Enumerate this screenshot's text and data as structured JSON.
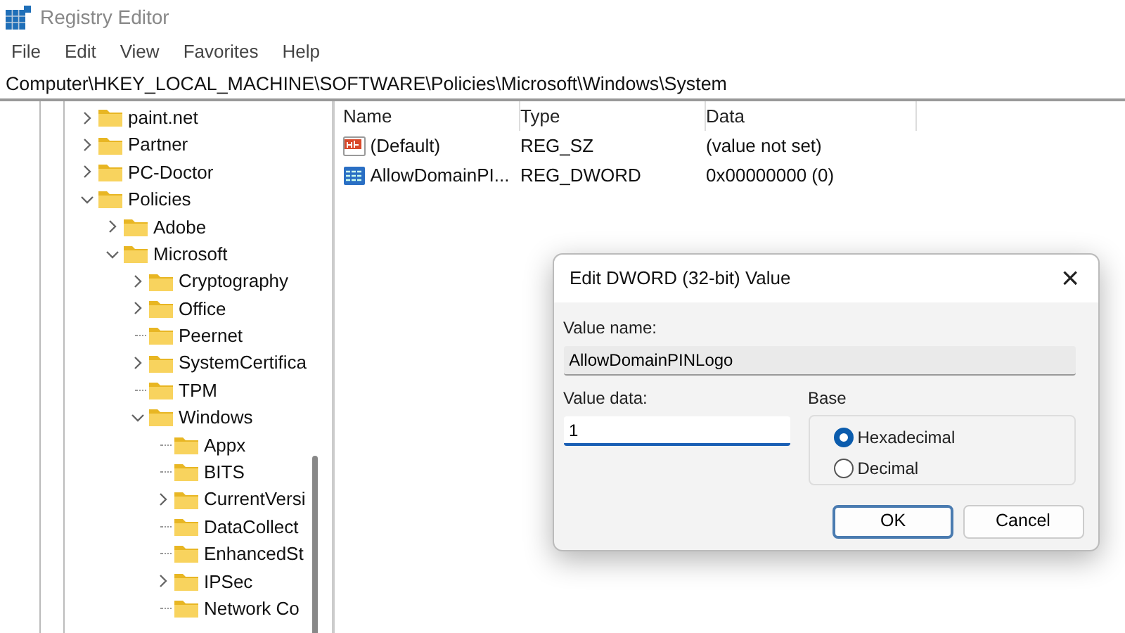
{
  "window": {
    "title": "Registry Editor"
  },
  "menu": [
    "File",
    "Edit",
    "View",
    "Favorites",
    "Help"
  ],
  "address": "Computer\\HKEY_LOCAL_MACHINE\\SOFTWARE\\Policies\\Microsoft\\Windows\\System",
  "tree": [
    {
      "label": "paint.net",
      "kind": "collapsed"
    },
    {
      "label": "Partner",
      "kind": "collapsed"
    },
    {
      "label": "PC-Doctor",
      "kind": "collapsed"
    },
    {
      "label": "Policies",
      "kind": "expanded",
      "children": [
        {
          "label": "Adobe",
          "kind": "collapsed"
        },
        {
          "label": "Microsoft",
          "kind": "expanded",
          "children": [
            {
              "label": "Cryptography",
              "kind": "collapsed"
            },
            {
              "label": "Office",
              "kind": "collapsed"
            },
            {
              "label": "Peernet",
              "kind": "leaf"
            },
            {
              "label": "SystemCertifica",
              "kind": "collapsed"
            },
            {
              "label": "TPM",
              "kind": "leaf"
            },
            {
              "label": "Windows",
              "kind": "expanded",
              "children": [
                {
                  "label": "Appx",
                  "kind": "leaf"
                },
                {
                  "label": "BITS",
                  "kind": "leaf"
                },
                {
                  "label": "CurrentVersi",
                  "kind": "collapsed"
                },
                {
                  "label": "DataCollect",
                  "kind": "leaf"
                },
                {
                  "label": "EnhancedSt",
                  "kind": "leaf"
                },
                {
                  "label": "IPSec",
                  "kind": "collapsed"
                },
                {
                  "label": "Network Co",
                  "kind": "leaf"
                }
              ]
            }
          ]
        }
      ]
    }
  ],
  "values": {
    "columns": [
      "Name",
      "Type",
      "Data"
    ],
    "rows": [
      {
        "kind": "string",
        "name": "(Default)",
        "type": "REG_SZ",
        "data": "(value not set)"
      },
      {
        "kind": "binary",
        "name": "AllowDomainPI...",
        "type": "REG_DWORD",
        "data": "0x00000000 (0)"
      }
    ]
  },
  "dialog": {
    "title": "Edit DWORD (32-bit) Value",
    "close": "×",
    "value_name_label": "Value name:",
    "value_name": "AllowDomainPINLogo",
    "value_data_label": "Value data:",
    "value_data": "1",
    "base_label": "Base",
    "base_options": [
      {
        "label": "Hexadecimal",
        "selected": true
      },
      {
        "label": "Decimal",
        "selected": false
      }
    ],
    "buttons": [
      {
        "label": "OK",
        "default": true
      },
      {
        "label": "Cancel",
        "default": false
      }
    ]
  }
}
